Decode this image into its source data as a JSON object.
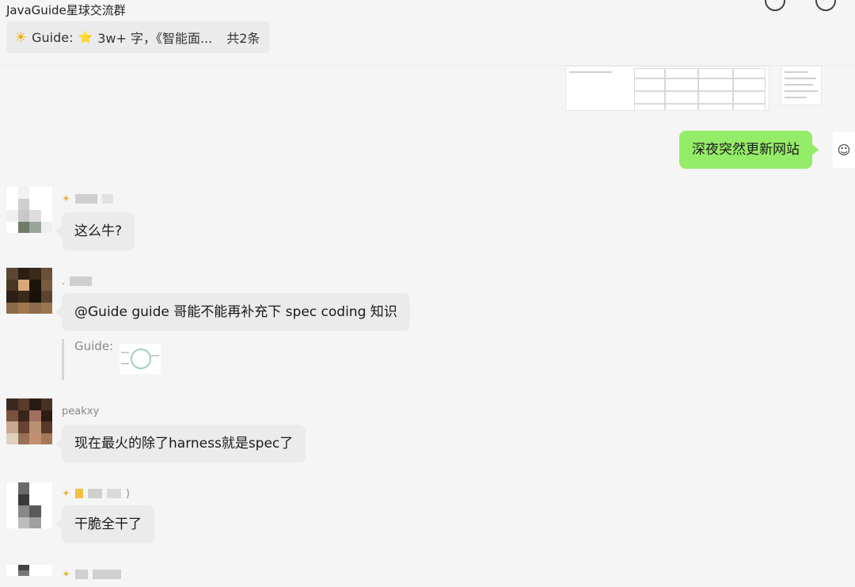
{
  "header": {
    "group_title": "JavaGuide星球交流群",
    "pinned": {
      "sender": "Guide:",
      "star": "⭐",
      "preview": "3w+ 字，《智能面...",
      "count": "共2条"
    }
  },
  "messages": [
    {
      "text": "深夜突然更新网站",
      "direction": "out"
    },
    {
      "sender": "",
      "text": "这么牛?",
      "direction": "in"
    },
    {
      "sender": ".",
      "text": "@Guide guide 哥能不能再补充下 spec coding 知识",
      "direction": "in",
      "quote": {
        "author": "Guide:"
      }
    },
    {
      "sender": "peakxy",
      "text": "现在最火的除了harness就是spec了",
      "direction": "in"
    },
    {
      "sender": ")",
      "text": "干脆全干了",
      "direction": "in"
    },
    {
      "sender": "",
      "text": "",
      "direction": "in"
    }
  ],
  "colors": {
    "outgoing_bubble": "#95ec69",
    "incoming_bubble": "#ebebeb",
    "background": "#f5f5f5"
  },
  "icons": [
    "sun-emoji-icon",
    "star-emoji-icon",
    "chat-icon",
    "phone-icon"
  ]
}
